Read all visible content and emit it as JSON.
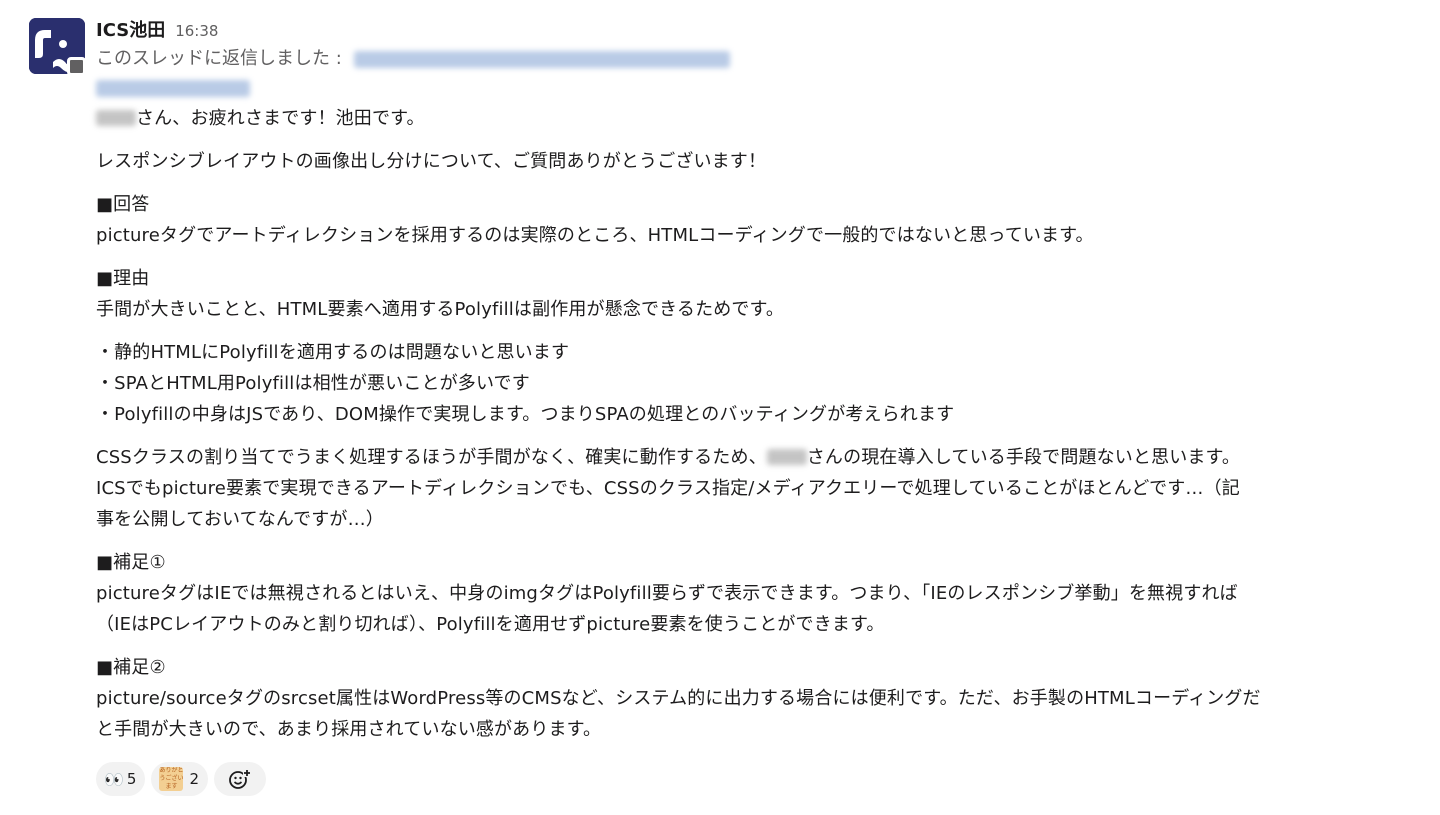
{
  "message": {
    "author": "ICS池田",
    "time": "16:38",
    "thread_prefix": "このスレッドに返信しました :",
    "greeting_suffix": "さん、お疲れさまです！池田です。",
    "paragraphs": {
      "intro": "レスポンシブレイアウトの画像出し分けについて、ご質問ありがとうございます！",
      "answer_heading": "■回答",
      "answer": "pictureタグでアートディレクションを採用するのは実際のところ、HTMLコーディングで一般的ではないと思っています。",
      "reason_heading": "■理由",
      "reason": "手間が大きいことと、HTML要素へ適用するPolyfillは副作用が懸念できるためです。",
      "bullet1": "・静的HTMLにPolyfillを適用するのは問題ないと思います",
      "bullet2": "・SPAとHTML用Polyfillは相性が悪いことが多いです",
      "bullet3": "・Polyfillの中身はJSであり、DOM操作で実現します。つまりSPAの処理とのバッティングが考えられます",
      "css_a": "CSSクラスの割り当てでうまく処理するほうが手間がなく、確実に動作するため、",
      "css_b": "さんの現在導入している手段で問題ないと思います。",
      "ics_line1": "ICSでもpicture要素で実現できるアートディレクションでも、CSSのクラス指定/メディアクエリーで処理していることがほとんどです…（記",
      "ics_line2": "事を公開しておいてなんですが…）",
      "supp1_heading": "■補足①",
      "supp1_line1": "pictureタグはIEでは無視されるとはいえ、中身のimgタグはPolyfill要らずで表示できます。つまり、「IEのレスポンシブ挙動」を無視すれば",
      "supp1_line2": "（IEはPCレイアウトのみと割り切れば）、Polyfillを適用せずpicture要素を使うことができます。",
      "supp2_heading": "■補足②",
      "supp2_line1": "picture/sourceタグのsrcset属性はWordPress等のCMSなど、システム的に出力する場合には便利です。ただ、お手製のHTMLコーディングだ",
      "supp2_line2": "と手間が大きいので、あまり採用されていない感があります。"
    }
  },
  "reactions": [
    {
      "icon": "eyes-emoji-icon",
      "glyph": "👀",
      "count": "5"
    },
    {
      "icon": "thank-you-emoji-icon",
      "glyph": "ありがとうございます",
      "count": "2"
    },
    {
      "icon": "add-reaction-icon"
    }
  ],
  "colors": {
    "avatar_bg": "#2a2f6e",
    "text": "#1d1c1d",
    "muted": "#616061",
    "link_blur": "#b9cbe6",
    "reaction_bg": "#f2f2f2"
  }
}
